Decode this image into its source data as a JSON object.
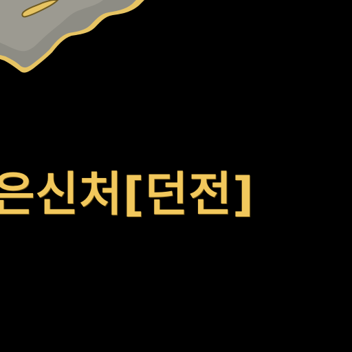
{
  "scene": {
    "background_color": "#000000",
    "accent_color": "#f2c85c",
    "map_fill_color": "#8d8c84",
    "map_border_color": "#e7c463"
  },
  "location": {
    "title": "은신처[던전]"
  },
  "icons": {
    "map_fragment": "map-fragment-icon"
  }
}
